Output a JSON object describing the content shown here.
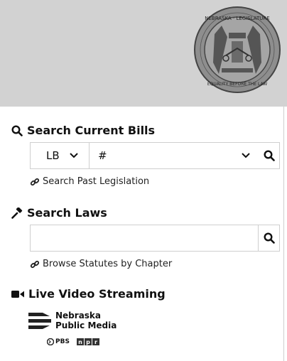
{
  "header": {
    "seal_text": "NEBRASKA LEGISLATURE · EQUALITY BEFORE THE LAW"
  },
  "bills": {
    "title": "Search Current Bills",
    "prefix_select": "LB",
    "number_select": "#",
    "past_link": "Search Past Legislation"
  },
  "laws": {
    "title": "Search Laws",
    "search_value": "",
    "browse_link": "Browse Statutes by Chapter"
  },
  "video": {
    "title": "Live Video Streaming",
    "npm_line1": "Nebraska",
    "npm_line2": "Public Media",
    "pbs": "PBS",
    "npr": [
      "n",
      "p",
      "r"
    ]
  },
  "colors": {
    "banner": "#d2d2d2",
    "border": "#cfcfcf",
    "text": "#111111"
  }
}
